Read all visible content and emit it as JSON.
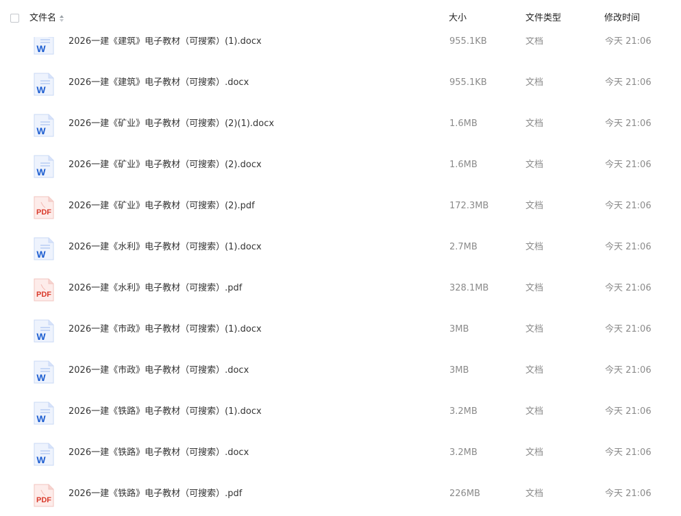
{
  "header": {
    "name_label": "文件名",
    "size_label": "大小",
    "type_label": "文件类型",
    "time_label": "修改时间"
  },
  "colors": {
    "word_blue": "#1f5fd1",
    "pdf_red": "#d93a2b",
    "muted_text": "#8a8a8a"
  },
  "files": [
    {
      "name": "2026一建《建筑》电子教材（可搜索）(1).docx",
      "size": "955.1KB",
      "type": "文档",
      "modified": "今天 21:06",
      "icon": "word-doc-icon"
    },
    {
      "name": "2026一建《建筑》电子教材（可搜索）.docx",
      "size": "955.1KB",
      "type": "文档",
      "modified": "今天 21:06",
      "icon": "word-doc-icon"
    },
    {
      "name": "2026一建《矿业》电子教材（可搜索）(2)(1).docx",
      "size": "1.6MB",
      "type": "文档",
      "modified": "今天 21:06",
      "icon": "word-doc-icon"
    },
    {
      "name": "2026一建《矿业》电子教材（可搜索）(2).docx",
      "size": "1.6MB",
      "type": "文档",
      "modified": "今天 21:06",
      "icon": "word-doc-icon"
    },
    {
      "name": "2026一建《矿业》电子教材（可搜索）(2).pdf",
      "size": "172.3MB",
      "type": "文档",
      "modified": "今天 21:06",
      "icon": "pdf-doc-icon"
    },
    {
      "name": "2026一建《水利》电子教材（可搜索）(1).docx",
      "size": "2.7MB",
      "type": "文档",
      "modified": "今天 21:06",
      "icon": "word-doc-icon"
    },
    {
      "name": "2026一建《水利》电子教材（可搜索）.pdf",
      "size": "328.1MB",
      "type": "文档",
      "modified": "今天 21:06",
      "icon": "pdf-doc-icon"
    },
    {
      "name": "2026一建《市政》电子教材（可搜索）(1).docx",
      "size": "3MB",
      "type": "文档",
      "modified": "今天 21:06",
      "icon": "word-doc-icon"
    },
    {
      "name": "2026一建《市政》电子教材（可搜索）.docx",
      "size": "3MB",
      "type": "文档",
      "modified": "今天 21:06",
      "icon": "word-doc-icon"
    },
    {
      "name": "2026一建《铁路》电子教材（可搜索）(1).docx",
      "size": "3.2MB",
      "type": "文档",
      "modified": "今天 21:06",
      "icon": "word-doc-icon"
    },
    {
      "name": "2026一建《铁路》电子教材（可搜索）.docx",
      "size": "3.2MB",
      "type": "文档",
      "modified": "今天 21:06",
      "icon": "word-doc-icon"
    },
    {
      "name": "2026一建《铁路》电子教材（可搜索）.pdf",
      "size": "226MB",
      "type": "文档",
      "modified": "今天 21:06",
      "icon": "pdf-doc-icon"
    }
  ]
}
